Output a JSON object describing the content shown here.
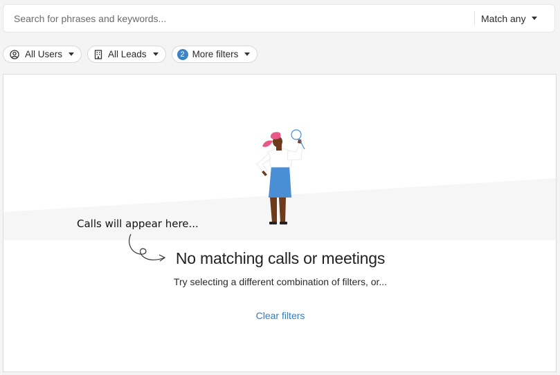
{
  "search": {
    "placeholder": "Search for phrases and keywords...",
    "value": "",
    "match_label": "Match any"
  },
  "filters": {
    "users_label": "All Users",
    "leads_label": "All Leads",
    "more_label": "More filters",
    "more_count": "2"
  },
  "empty_state": {
    "annotation": "Calls will appear here...",
    "title": "No matching calls or meetings",
    "description": "Try selecting a different combination of filters, or...",
    "clear_label": "Clear filters"
  },
  "colors": {
    "accent": "#2f7bbf",
    "badge": "#3d84c6",
    "figure_hair": "#e8598a",
    "figure_skirt": "#4a8fd6"
  },
  "icons": {
    "users": "user-circle-icon",
    "leads": "building-icon",
    "dropdown": "chevron-down-icon",
    "illustration": "magnifying-glass-icon"
  }
}
